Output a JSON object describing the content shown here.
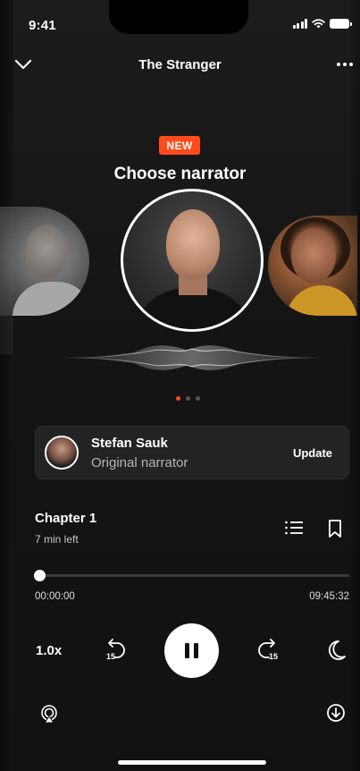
{
  "status_bar": {
    "time": "9:41"
  },
  "header": {
    "title": "The Stranger"
  },
  "promo": {
    "badge": "NEW",
    "heading": "Choose narrator"
  },
  "carousel": {
    "active_index": 0,
    "count": 3,
    "accent_color": "#ff4a1c"
  },
  "narrator_card": {
    "name": "Stefan Sauk",
    "role": "Original narrator",
    "action_label": "Update"
  },
  "chapter": {
    "title": "Chapter 1",
    "remaining": "7 min left"
  },
  "progress": {
    "current": "00:00:00",
    "total": "09:45:32",
    "fraction": 0.0
  },
  "controls": {
    "speed_label": "1.0x",
    "skip_back_label": "15",
    "skip_forward_label": "15"
  },
  "icons": {
    "back": "chevron-down-icon",
    "more": "more-horizontal-icon",
    "chapters": "list-icon",
    "bookmark": "bookmark-icon",
    "rewind": "rewind-15-icon",
    "pause": "pause-icon",
    "forward": "forward-15-icon",
    "sleep": "moon-icon",
    "airplay": "airplay-icon",
    "download": "download-icon"
  }
}
